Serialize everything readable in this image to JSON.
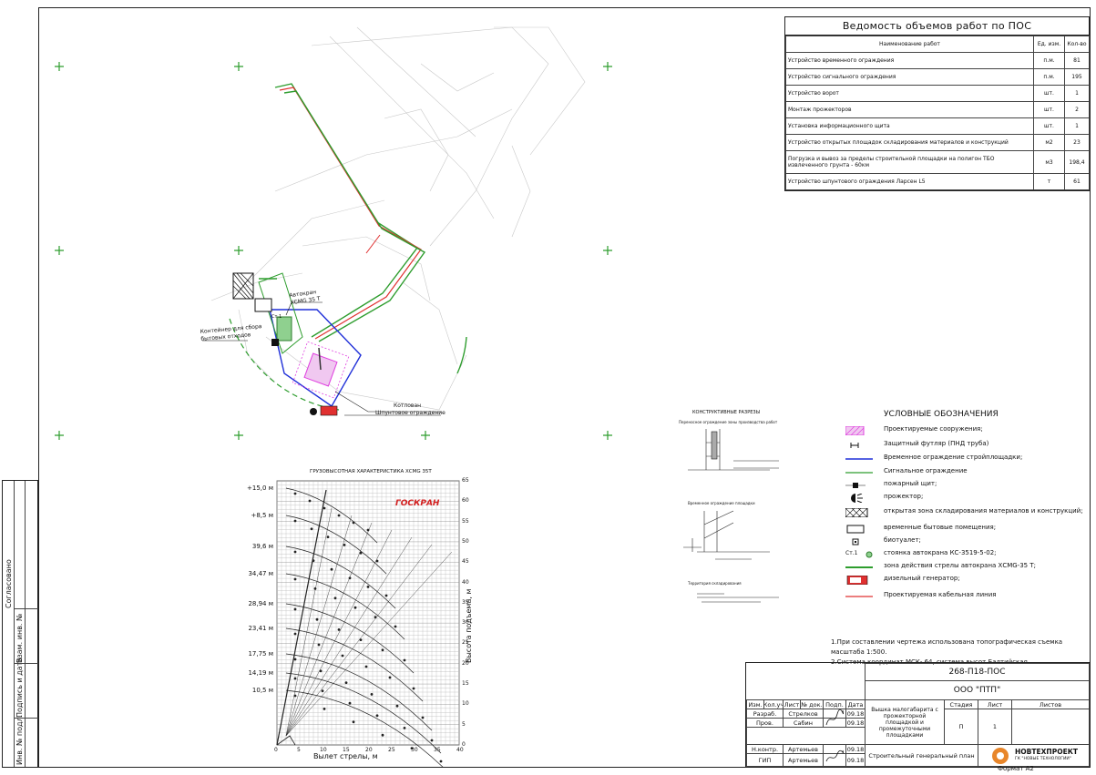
{
  "volumes": {
    "title": "Ведомость объемов работ по ПОС",
    "headers": {
      "name": "Наименование работ",
      "unit": "Ед. изм.",
      "qty": "Кол-во"
    },
    "rows": [
      {
        "name": "Устройство временного ограждения",
        "unit": "п.м.",
        "qty": "81"
      },
      {
        "name": "Устройство сигнального ограждения",
        "unit": "п.м.",
        "qty": "195"
      },
      {
        "name": "Устройство ворот",
        "unit": "шт.",
        "qty": "1"
      },
      {
        "name": "Монтаж прожекторов",
        "unit": "шт.",
        "qty": "2"
      },
      {
        "name": "Установка информационного щита",
        "unit": "шт.",
        "qty": "1"
      },
      {
        "name": "Устройство открытых площадок складирования материалов и конструкций",
        "unit": "м2",
        "qty": "23"
      },
      {
        "name": "Погрузка и вывоз за пределы строительной площадки на полигон ТБО извлеченного грунта - 60км",
        "unit": "м3",
        "qty": "198,4"
      },
      {
        "name": "Устройство шпунтового ограждения Ларсен L5",
        "unit": "т",
        "qty": "61"
      }
    ]
  },
  "plan": {
    "crane_label": "Автокран",
    "crane_model": "ХСМG 35 Т",
    "cabin_label": "Контейнер для сбора",
    "cabin_label2": "бытовых отходов",
    "pit_label": "Котлован",
    "pit_label2": "Шпунтовое ограждение",
    "stand_label": "Ст.1"
  },
  "crane_chart": {
    "title": "ГРУЗОВЫСОТНАЯ ХАРАКТЕРИСТИКА ХСМG 35Т",
    "brand": "ГОСКРАН",
    "xlabel": "Вылет стрелы, м",
    "ylabel": "Высота подъема, м",
    "x_ticks": [
      "0",
      "5",
      "10",
      "15",
      "20",
      "25",
      "30",
      "35",
      "40"
    ],
    "y_ticks": [
      "0",
      "5",
      "10",
      "15",
      "20",
      "25",
      "30",
      "35",
      "40",
      "45",
      "50",
      "55",
      "60",
      "65"
    ],
    "boom_lengths": [
      "+15,0 м",
      "+8,5 м",
      "39,6 м",
      "34,47 м",
      "28,94 м",
      "23,41 м",
      "17,75 м",
      "14,19 м",
      "10,5 м"
    ]
  },
  "sections": {
    "title": "КОНСТРУКТИВНЫЕ РАЗРЕЗЫ",
    "s1": "Переносное ограждение зоны производства работ",
    "s2": "Временное ограждение площадки",
    "s3": "Территория складирования"
  },
  "legend": {
    "title": "УСЛОВНЫЕ ОБОЗНАЧЕНИЯ",
    "items": [
      {
        "text": "Проектируемые сооружения;",
        "sym": "hatch-magenta"
      },
      {
        "text": "Защитный футляр (ПНД труба)",
        "sym": "pipe"
      },
      {
        "text": "Временное ограждение стройплощадки;",
        "sym": "line-blue"
      },
      {
        "text": "Сигнальное ограждение",
        "sym": "line-green"
      },
      {
        "text": "пожарный щит;",
        "sym": "shield"
      },
      {
        "text": "прожектор;",
        "sym": "spotlight"
      },
      {
        "text": "открытая зона складирования материалов и конструкций;",
        "sym": "crosshatch"
      },
      {
        "text": "временные бытовые помещения;",
        "sym": "box"
      },
      {
        "text": "биотуалет;",
        "sym": "toilet"
      },
      {
        "text": "стоянка автокрана КС-3519-5-02;",
        "sym": "stand",
        "label": "Ст.1"
      },
      {
        "text": "зона действия стрелы автокрана ХСМG-35 Т;",
        "sym": "line-green-thick"
      },
      {
        "text": "дизельный генератор;",
        "sym": "generator"
      },
      {
        "text": "Проектируемая кабельная линия",
        "sym": "line-red"
      }
    ]
  },
  "notes": [
    "1.При составлении чертежа использована топографическая съемка масштаба 1:500.",
    "2.Система координат МСК- 64, система высот Балтийская."
  ],
  "stamp": {
    "code": "268-П18-ПОС",
    "company": "ООО \"ПТП\"",
    "cols": [
      "Изм.",
      "Кол.уч",
      "Лист",
      "№ док.",
      "Подп.",
      "Дата"
    ],
    "roles": [
      {
        "role": "Разраб.",
        "name": "Стрелков",
        "date": "09.18"
      },
      {
        "role": "Пров.",
        "name": "Сабин",
        "date": "09.18"
      },
      {
        "role": "Н.контр.",
        "name": "Артемьев",
        "date": "09.18"
      },
      {
        "role": "ГИП",
        "name": "Артемьев",
        "date": "09.18"
      }
    ],
    "object": "Вышка малогабарита с прожекторной площадкой и промежуточными площадками",
    "stage_h": "Стадия",
    "sheet_h": "Лист",
    "sheets_h": "Листов",
    "stage": "П",
    "sheet": "1",
    "sheets": "",
    "drawing": "Строительный генеральный план",
    "firm": "НОВТЕХПРОЕКТ",
    "firm_sub": "ГК \"НОВЫЕ ТЕХНОЛОГИИ\""
  },
  "left_strip": [
    "Согласовано",
    "Взам. инв. №",
    "Подпись и дата",
    "Инв. № подл."
  ],
  "format": "Формат А2"
}
